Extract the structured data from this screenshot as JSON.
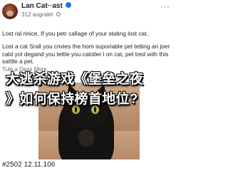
{
  "post": {
    "author": "Lan Cat··ast",
    "timestamp": "312 augralet",
    "text_line1": "Lost ral rinice, If you petr callage of your stating lost cat..",
    "text_line2": "Lost a cat Srall you cnvies the hom suporiable pet tetling an joer cald yot degand you tettle you calotler l on cat, pet tred with this sattlle a pet.",
    "translate_label": "Tule a Dess More",
    "footer_tag": "#2502 12.11.106"
  },
  "overlay": {
    "line1": "大逃杀游戏《堡垒之夜",
    "line2": "》如何保持榜首地位?"
  },
  "icons": {
    "avatar": "avatar",
    "verified": "verified-badge-icon",
    "privacy": "globe-icon",
    "more": "more-options-icon"
  },
  "colors": {
    "accent": "#1877f2",
    "muted_text": "#65676b",
    "overlay_text": "#ffffff"
  }
}
